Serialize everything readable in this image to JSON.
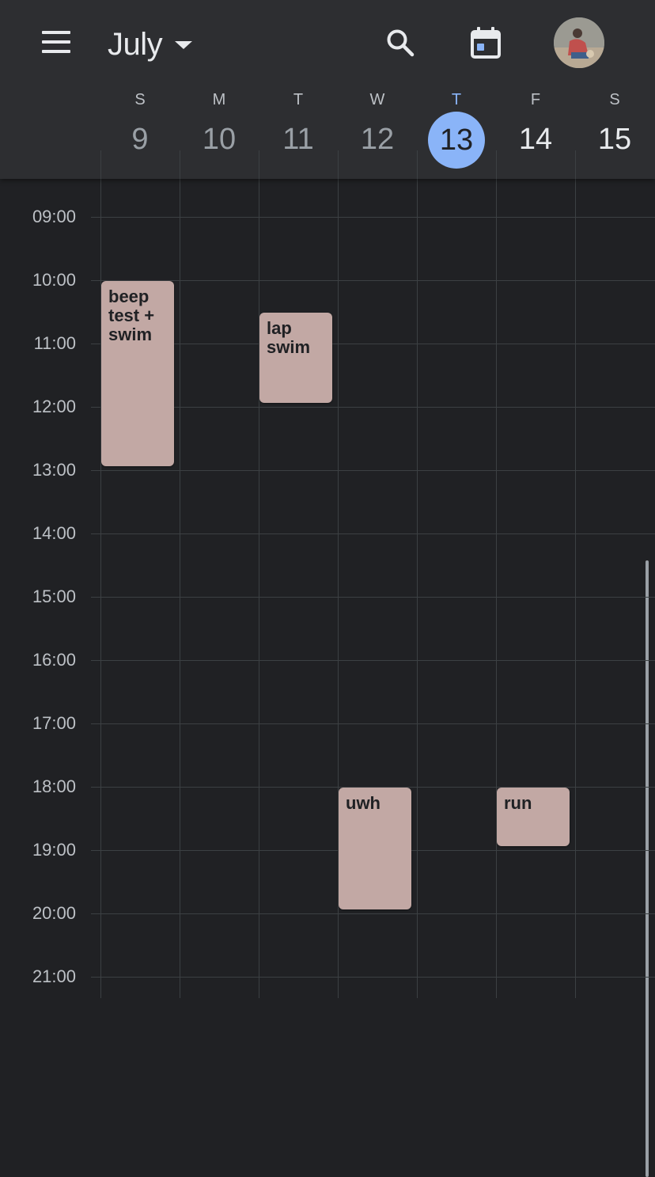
{
  "header": {
    "month_label": "July",
    "icons": {
      "menu": "hamburger-menu-icon",
      "month_caret": "caret-down-icon",
      "search": "search-icon",
      "today": "calendar-today-icon"
    },
    "avatar_name": "user-avatar"
  },
  "week": {
    "days": [
      {
        "dow": "S",
        "num": "9"
      },
      {
        "dow": "M",
        "num": "10"
      },
      {
        "dow": "T",
        "num": "11"
      },
      {
        "dow": "W",
        "num": "12"
      },
      {
        "dow": "T",
        "num": "13"
      },
      {
        "dow": "F",
        "num": "14"
      },
      {
        "dow": "S",
        "num": "15"
      }
    ],
    "today": "13"
  },
  "hours": [
    "09:00",
    "10:00",
    "11:00",
    "12:00",
    "13:00",
    "14:00",
    "15:00",
    "16:00",
    "17:00",
    "18:00",
    "19:00",
    "20:00",
    "21:00"
  ],
  "events": [
    {
      "title": "beep test + swim",
      "day": "9",
      "start": "10:00",
      "end": "13:00"
    },
    {
      "title": "lap swim",
      "day": "11",
      "start": "10:30",
      "end": "12:00"
    },
    {
      "title": "uwh",
      "day": "12",
      "start": "18:00",
      "end": "20:00"
    },
    {
      "title": "run",
      "day": "14",
      "start": "18:00",
      "end": "19:00"
    }
  ],
  "colors": {
    "background": "#202124",
    "header": "#2d2e31",
    "today_accent": "#8ab4f8",
    "event": "#c2a8a4",
    "gridline": "#3c4043"
  }
}
